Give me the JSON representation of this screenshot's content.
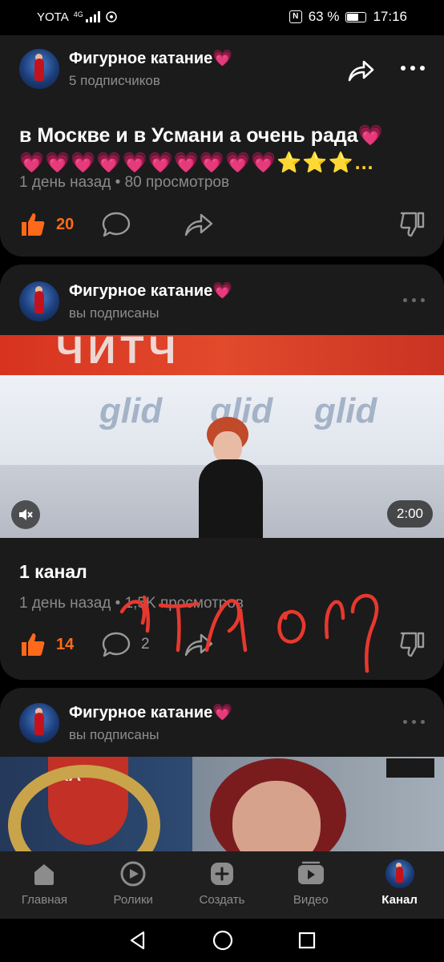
{
  "status_bar": {
    "carrier": "YOTA",
    "network": "4G",
    "battery": "63 %",
    "time": "17:16"
  },
  "post1": {
    "channel_name": "Фигурное катание",
    "channel_sub": "5 подписчиков",
    "text_line1": "в Москве и в Усмани а очень рада",
    "emoji_line_hearts": "💗💗💗💗💗💗💗💗💗💗",
    "emoji_line_stars": "⭐⭐⭐…",
    "meta": "1 день назад • 80 просмотров",
    "likes": "20"
  },
  "post2": {
    "channel_name": "Фигурное катание",
    "channel_sub": "вы подписаны",
    "video_duration": "2:00",
    "title": "1 канал",
    "meta": "1 день назад • 1,5K просмотров",
    "likes": "14",
    "comments": "2"
  },
  "post3": {
    "channel_name": "Фигурное катание",
    "channel_sub": "вы подписаны"
  },
  "bottom_nav": {
    "items": [
      {
        "label": "Главная",
        "icon": "home-icon"
      },
      {
        "label": "Ролики",
        "icon": "clips-icon"
      },
      {
        "label": "Создать",
        "icon": "create-icon"
      },
      {
        "label": "Видео",
        "icon": "video-icon"
      },
      {
        "label": "Канал",
        "icon": "channel-avatar"
      }
    ],
    "active": "Канал"
  },
  "colors": {
    "accent_like": "#ff6a1a",
    "card_bg": "#1b1b1b",
    "scribble": "#e8382e"
  }
}
